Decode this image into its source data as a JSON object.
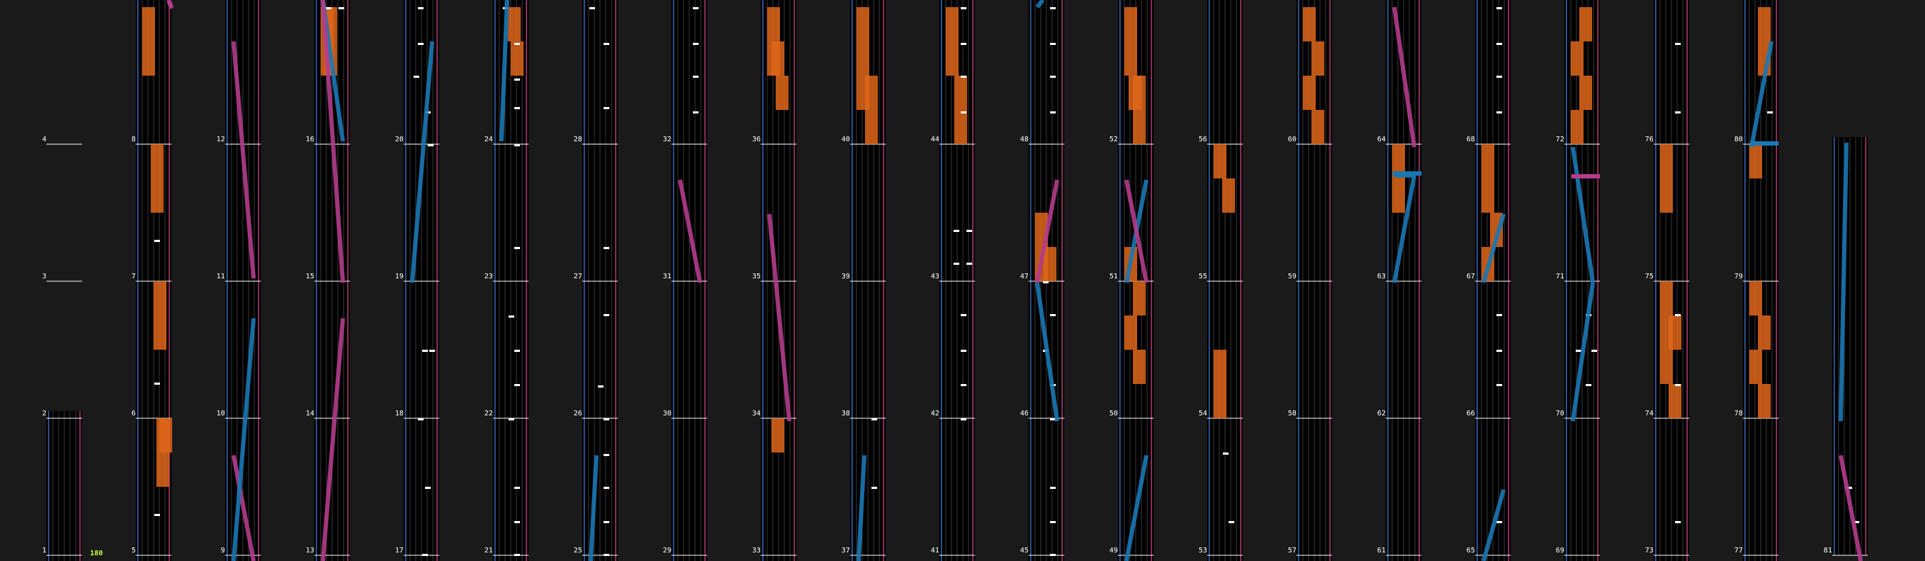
{
  "chart": {
    "title": "",
    "bpm_label": "180",
    "colors": {
      "background": "#1a1a1a",
      "lane_background": "#000000",
      "gridline": "#3a3a3a",
      "measure_line": "#ffffff",
      "left_border": "#2c4f8c",
      "right_border": "#8c2c5c",
      "note": "#ffffff",
      "hold_orange": "#e0661a",
      "laser_blue": "#1a78b4",
      "laser_pink": "#b43c8c"
    },
    "measure_labels": [
      "1",
      "2",
      "3",
      "4",
      "5",
      "6",
      "7",
      "8",
      "9",
      "10",
      "11",
      "12",
      "13",
      "14",
      "15",
      "16",
      "17",
      "18",
      "19",
      "20",
      "21",
      "22",
      "23",
      "24",
      "25",
      "26",
      "27",
      "28",
      "29",
      "30",
      "31",
      "32",
      "33",
      "34",
      "35",
      "36",
      "37",
      "38",
      "39",
      "40",
      "41",
      "42",
      "43",
      "44",
      "45",
      "46",
      "47",
      "48",
      "49",
      "50",
      "51",
      "52",
      "53",
      "54",
      "55",
      "56",
      "57",
      "58",
      "59",
      "60",
      "61",
      "62",
      "63",
      "64",
      "65",
      "66",
      "67",
      "68",
      "69",
      "70",
      "71",
      "72",
      "73",
      "74",
      "75",
      "76",
      "77",
      "78",
      "79",
      "80",
      "81"
    ]
  }
}
